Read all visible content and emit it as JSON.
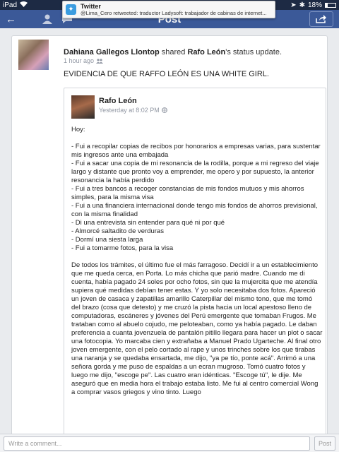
{
  "status_bar": {
    "device": "iPad",
    "battery": "18%",
    "battery_level": 0.18
  },
  "nav": {
    "title": "Post"
  },
  "notification": {
    "app": "Twitter",
    "text": "@Lima_Cero retweeted: traductor Ladysoft: trabajador de cabinas de internet..."
  },
  "post": {
    "author": "Dahiana Gallegos Llontop",
    "shared_text": "shared",
    "original_author": "Rafo León",
    "shared_suffix": "'s status update.",
    "time": "1 hour ago",
    "status": "EVIDENCIA DE QUE RAFFO LEÓN ES UNA WHITE GIRL.",
    "shared_post": {
      "author": "Rafo León",
      "time": "Yesterday at 8:02 PM",
      "greeting": "Hoy:",
      "list": [
        "- Fui a recopilar copias de recibos por honorarios a empresas varias, para sustentar mis ingresos ante una embajada",
        "- Fui a sacar una copia de mi resonancia de la rodilla, porque a mi regreso del viaje largo y distante que pronto voy a emprender, me opero y por supuesto, la anterior resonancia la había perdido",
        "- Fui a tres bancos a recoger constancias de mis fondos mutuos y mis ahorros simples, para la misma visa",
        "- Fui a una financiera internacional donde tengo mis fondos de ahorros previsional, con la misma finalidad",
        "- Di una entrevista sin entender para qué ni por qué",
        "- Almorcé saltadito de verduras",
        "- Dormí una siesta larga",
        "- Fui a tomarme fotos, para la visa"
      ],
      "paragraph": "De todos los trámites, el último fue el más farragoso. Decidí ir a un establecimiento que me queda cerca, en Porta. Lo más chicha que parió madre. Cuando me di cuenta, había pagado 24 soles por ocho fotos, sin que la mujercita que me atendía supiera qué medidas debían tener estas. Y yo solo necesitaba dos fotos. Apareció un joven de casaca y zapatillas amarillo Caterpillar del mismo tono, que me tomó del brazo (cosa que detesto) y me cruzó la pista hacia un local apestoso lleno de computadoras, escáneres y jóvenes del Perú emergente que tomaban Frugos. Me trataban como al abuelo cojudo, me peloteaban, como ya había pagado. Le daban preferencia a cuanta jovenzuela de pantalón pitillo llegara para hacer un plot o sacar una fotocopia. Yo marcaba cien y extrañaba a Manuel Prado Ugarteche. Al final otro joven emergente, con el pelo cortado al rape y unos trinches sobre los que tirabas una naranja y se quedaba ensartada, me dijo, \"ya pe tío, ponte acá\". Arrimó a una señora gorda y me puso de espaldas a un ecran mugroso. Tomó cuatro fotos y luego me dijo, \"escoge pe\". Las cuatro eran idénticas. \"Escoge tú\", le dije. Me aseguró que en media hora el trabajo estaba listo. Me fui al centro comercial Wong a comprar vasos griegos y vino tinto. Luego"
    }
  },
  "comment_bar": {
    "placeholder": "Write a comment...",
    "post_label": "Post"
  }
}
